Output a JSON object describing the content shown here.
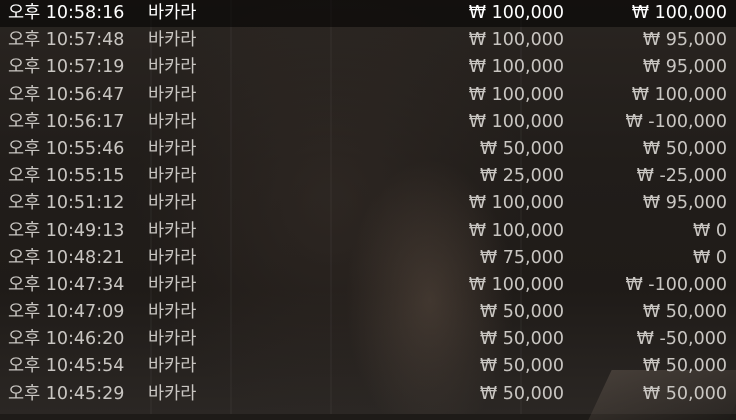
{
  "rows": [
    {
      "time": "오후 10:58:16",
      "game": "바카라",
      "bet": "₩ 100,000",
      "result": "₩ 100,000"
    },
    {
      "time": "오후 10:57:48",
      "game": "바카라",
      "bet": "₩ 100,000",
      "result": "₩ 95,000"
    },
    {
      "time": "오후 10:57:19",
      "game": "바카라",
      "bet": "₩ 100,000",
      "result": "₩ 95,000"
    },
    {
      "time": "오후 10:56:47",
      "game": "바카라",
      "bet": "₩ 100,000",
      "result": "₩ 100,000"
    },
    {
      "time": "오후 10:56:17",
      "game": "바카라",
      "bet": "₩ 100,000",
      "result": "₩ -100,000"
    },
    {
      "time": "오후 10:55:46",
      "game": "바카라",
      "bet": "₩ 50,000",
      "result": "₩ 50,000"
    },
    {
      "time": "오후 10:55:15",
      "game": "바카라",
      "bet": "₩ 25,000",
      "result": "₩ -25,000"
    },
    {
      "time": "오후 10:51:12",
      "game": "바카라",
      "bet": "₩ 100,000",
      "result": "₩ 95,000"
    },
    {
      "time": "오후 10:49:13",
      "game": "바카라",
      "bet": "₩ 100,000",
      "result": "₩ 0"
    },
    {
      "time": "오후 10:48:21",
      "game": "바카라",
      "bet": "₩ 75,000",
      "result": "₩ 0"
    },
    {
      "time": "오후 10:47:34",
      "game": "바카라",
      "bet": "₩ 100,000",
      "result": "₩ -100,000"
    },
    {
      "time": "오후 10:47:09",
      "game": "바카라",
      "bet": "₩ 50,000",
      "result": "₩ 50,000"
    },
    {
      "time": "오후 10:46:20",
      "game": "바카라",
      "bet": "₩ 50,000",
      "result": "₩ -50,000"
    },
    {
      "time": "오후 10:45:54",
      "game": "바카라",
      "bet": "₩ 50,000",
      "result": "₩ 50,000"
    },
    {
      "time": "오후 10:45:29",
      "game": "바카라",
      "bet": "₩ 50,000",
      "result": "₩ 50,000"
    }
  ]
}
